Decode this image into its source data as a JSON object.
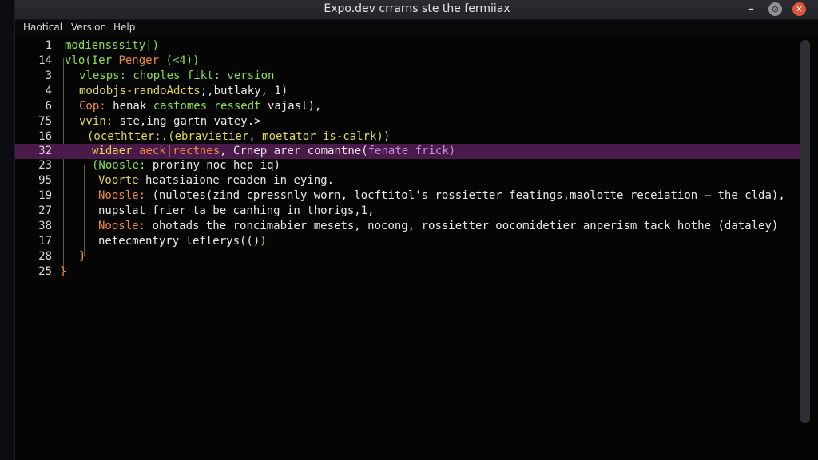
{
  "window": {
    "title": "Expo.dev crrarns ste the fermiiax",
    "controls": {
      "minimize": "–",
      "maximize": "⊙",
      "close": "✕"
    }
  },
  "menu": {
    "items": [
      "Haotical",
      "Version",
      "Help"
    ]
  },
  "editor": {
    "lines": [
      {
        "num": "1",
        "segments": [
          {
            "text": "modiensssity|)",
            "color": "green"
          }
        ]
      },
      {
        "num": "14",
        "segments": [
          {
            "text": "vlo(Ier ",
            "color": "green"
          },
          {
            "text": "Penger",
            "color": "orange"
          },
          {
            "text": " (<4))",
            "color": "green"
          }
        ]
      },
      {
        "num": "3",
        "segments": [
          {
            "text": "vlesps: choples fikt: version",
            "color": "green"
          }
        ]
      },
      {
        "num": "4",
        "segments": [
          {
            "text": "modobjs-randoAdcts",
            "color": "yellow"
          },
          {
            "text": ";,butlaky, 1)",
            "color": "white"
          }
        ]
      },
      {
        "num": "6",
        "segments": [
          {
            "text": "Cop:",
            "color": "orange"
          },
          {
            "text": " henak ",
            "color": "white"
          },
          {
            "text": "castomes ressedt",
            "color": "green"
          },
          {
            "text": " vajasl),",
            "color": "white"
          }
        ]
      },
      {
        "num": "75",
        "segments": [
          {
            "text": "vvin:",
            "color": "yellow"
          },
          {
            "text": " ste,ing gartn vatey.>",
            "color": "white"
          }
        ]
      },
      {
        "num": "16",
        "segments": [
          {
            "text": "(ocethtter:.(ebravietier, moetator is-calrk))",
            "color": "yellow"
          }
        ]
      },
      {
        "num": "32",
        "highlight": true,
        "segments": [
          {
            "text": "widaer ",
            "color": "yellow"
          },
          {
            "text": "aeck|rectnes",
            "color": "orange"
          },
          {
            "text": ", Crnep arer comantne(",
            "color": "white"
          },
          {
            "text": "fenate frick)",
            "color": "purple"
          }
        ]
      },
      {
        "num": "23",
        "segments": [
          {
            "text": "(Noosle:",
            "color": "green"
          },
          {
            "text": " proriny noc hep iq)",
            "color": "white"
          }
        ]
      },
      {
        "num": "95",
        "segments": [
          {
            "text": "Voorte",
            "color": "yellow"
          },
          {
            "text": " heatsiaione readen in eying.",
            "color": "white"
          }
        ]
      },
      {
        "num": "19",
        "segments": [
          {
            "text": "Noosle:",
            "color": "orange"
          },
          {
            "text": " (nulotes(zind cpressnly worn, locftitol's rossietter featings,maolotte receiation – the clda),",
            "color": "white"
          }
        ]
      },
      {
        "num": "27",
        "segments": [
          {
            "text": "nupslat frier ta be canhing in thorigs,1,",
            "color": "white"
          }
        ]
      },
      {
        "num": "38",
        "segments": [
          {
            "text": "Noosle:",
            "color": "orange"
          },
          {
            "text": " ohotads the roncimabier_mesets, nocong, rossietter oocomidetier anperism tack hothe (dataley)",
            "color": "white"
          }
        ]
      },
      {
        "num": "17",
        "segments": [
          {
            "text": "netecmentyry leflerys(()",
            "color": "white"
          },
          {
            "text": ")",
            "color": "green"
          }
        ]
      },
      {
        "num": "28",
        "segments": [
          {
            "text": "}",
            "color": "orange"
          }
        ]
      },
      {
        "num": "25",
        "segments": [
          {
            "text": "}",
            "color": "orange"
          }
        ]
      }
    ]
  },
  "colors": {
    "green": "#86e04b",
    "orange": "#f08a3c",
    "yellow": "#e3d84e",
    "white": "#e8e8e8",
    "purple": "#c98ae8",
    "highlight_bg": "#4a1b4a"
  }
}
